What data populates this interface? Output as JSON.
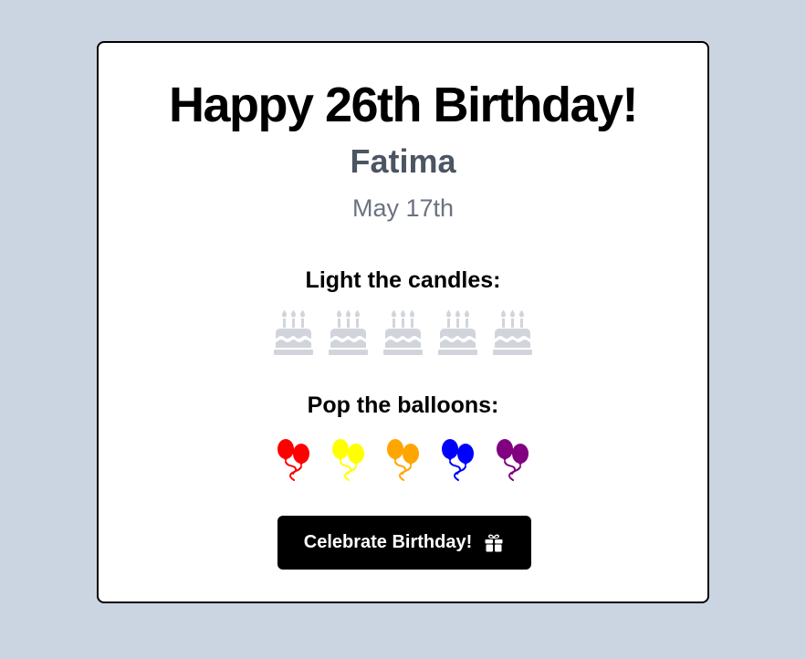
{
  "card": {
    "title": "Happy 26th Birthday!",
    "name": "Fatima",
    "date": "May 17th"
  },
  "candles": {
    "heading": "Light the candles:",
    "count": 5,
    "icon": "birthday-cake-icon",
    "color": "#d1d5db"
  },
  "balloons": {
    "heading": "Pop the balloons:",
    "icon": "balloons-icon",
    "colors": [
      "#ff0000",
      "#ffff00",
      "#ffa500",
      "#0000ff",
      "#800080"
    ]
  },
  "button": {
    "label": "Celebrate Birthday!",
    "icon": "gift-icon"
  },
  "colors": {
    "page_background": "#cbd5e1",
    "card_background": "#ffffff",
    "title": "#000000",
    "name": "#4b5563",
    "date": "#6b7280",
    "button_background": "#000000",
    "button_text": "#ffffff"
  }
}
